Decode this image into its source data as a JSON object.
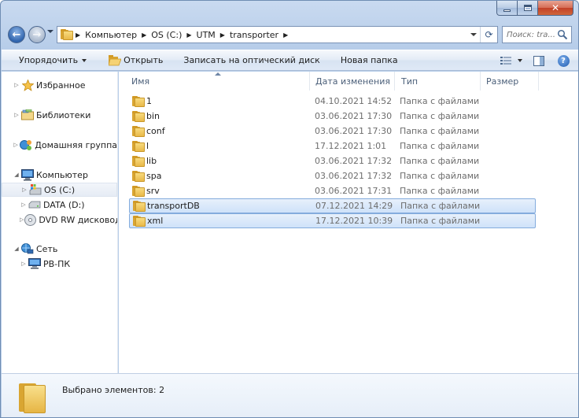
{
  "address": {
    "segments": [
      "Компьютер",
      "OS (C:)",
      "UTM",
      "transporter"
    ]
  },
  "search": {
    "placeholder": "Поиск: tra..."
  },
  "toolbar": {
    "organize": "Упорядочить",
    "open": "Открыть",
    "burn": "Записать на оптический диск",
    "new_folder": "Новая папка"
  },
  "nav": {
    "favorites": "Избранное",
    "libraries": "Библиотеки",
    "homegroup": "Домашняя группа",
    "computer": "Компьютер",
    "drive_c": "OS (C:)",
    "drive_d": "DATA (D:)",
    "dvd": "DVD RW дисковод (",
    "network": "Сеть",
    "network_pc": "PB-ПК"
  },
  "columns": {
    "name": "Имя",
    "date": "Дата изменения",
    "type": "Тип",
    "size": "Размер"
  },
  "files": [
    {
      "name": "1",
      "date": "04.10.2021 14:52",
      "type": "Папка с файлами",
      "selected": false
    },
    {
      "name": "bin",
      "date": "03.06.2021 17:30",
      "type": "Папка с файлами",
      "selected": false
    },
    {
      "name": "conf",
      "date": "03.06.2021 17:30",
      "type": "Папка с файлами",
      "selected": false
    },
    {
      "name": "l",
      "date": "17.12.2021 1:01",
      "type": "Папка с файлами",
      "selected": false
    },
    {
      "name": "lib",
      "date": "03.06.2021 17:32",
      "type": "Папка с файлами",
      "selected": false
    },
    {
      "name": "spa",
      "date": "03.06.2021 17:32",
      "type": "Папка с файлами",
      "selected": false
    },
    {
      "name": "srv",
      "date": "03.06.2021 17:31",
      "type": "Папка с файлами",
      "selected": false
    },
    {
      "name": "transportDB",
      "date": "07.12.2021 14:29",
      "type": "Папка с файлами",
      "selected": true
    },
    {
      "name": "xml",
      "date": "17.12.2021 10:39",
      "type": "Папка с файлами",
      "selected": true
    }
  ],
  "details": {
    "status": "Выбрано элементов: 2"
  }
}
